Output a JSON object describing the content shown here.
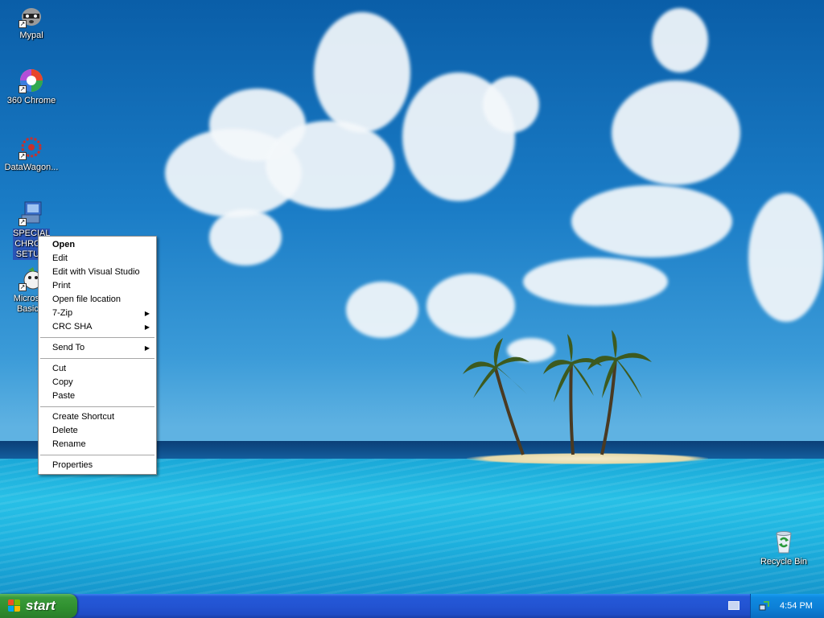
{
  "desktop_icons": [
    {
      "label": "Mypal",
      "icon": "raccoon-icon"
    },
    {
      "label": "360 Chrome",
      "icon": "chrome-360-icon"
    },
    {
      "label": "DataWagon...",
      "icon": "datawagon-icon"
    },
    {
      "label_line1": "SPECIAL",
      "label_line2": "CHRO...",
      "label_line3": "SETU...",
      "icon": "setup-icon"
    },
    {
      "label_line1": "Microsoft",
      "label_line2": "Basic 6",
      "icon": "vb6-icon"
    },
    {
      "label": "Recycle Bin",
      "icon": "recycle-bin-icon"
    }
  ],
  "context_menu": {
    "group1": [
      "Open",
      "Edit",
      "Edit with Visual Studio",
      "Print",
      "Open file location",
      "7-Zip",
      "CRC SHA"
    ],
    "group2": [
      "Send To"
    ],
    "group3": [
      "Cut",
      "Copy",
      "Paste"
    ],
    "group4": [
      "Create Shortcut",
      "Delete",
      "Rename"
    ],
    "group5": [
      "Properties"
    ],
    "submenu_arrow": "▶"
  },
  "taskbar": {
    "start_label": "start",
    "clock": "4:54 PM"
  },
  "colors": {
    "taskbar": "#2458d8",
    "start_green": "#3a9b3a",
    "tray": "#0f8ae0"
  }
}
